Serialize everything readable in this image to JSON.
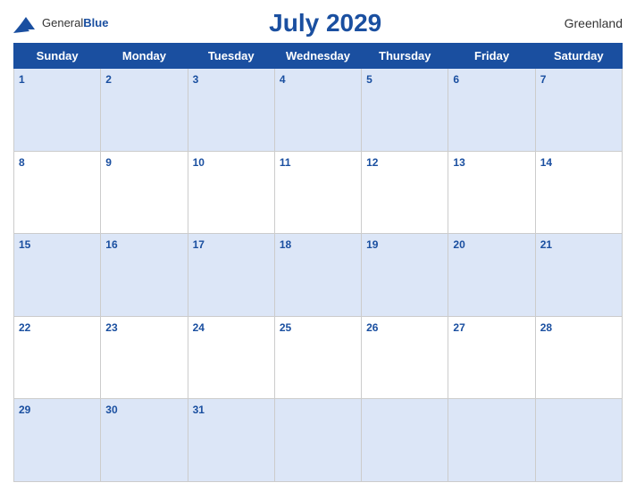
{
  "header": {
    "logo_general": "General",
    "logo_blue": "Blue",
    "title": "July 2029",
    "region": "Greenland"
  },
  "calendar": {
    "days_of_week": [
      "Sunday",
      "Monday",
      "Tuesday",
      "Wednesday",
      "Thursday",
      "Friday",
      "Saturday"
    ],
    "weeks": [
      [
        {
          "day": 1,
          "empty": false
        },
        {
          "day": 2,
          "empty": false
        },
        {
          "day": 3,
          "empty": false
        },
        {
          "day": 4,
          "empty": false
        },
        {
          "day": 5,
          "empty": false
        },
        {
          "day": 6,
          "empty": false
        },
        {
          "day": 7,
          "empty": false
        }
      ],
      [
        {
          "day": 8,
          "empty": false
        },
        {
          "day": 9,
          "empty": false
        },
        {
          "day": 10,
          "empty": false
        },
        {
          "day": 11,
          "empty": false
        },
        {
          "day": 12,
          "empty": false
        },
        {
          "day": 13,
          "empty": false
        },
        {
          "day": 14,
          "empty": false
        }
      ],
      [
        {
          "day": 15,
          "empty": false
        },
        {
          "day": 16,
          "empty": false
        },
        {
          "day": 17,
          "empty": false
        },
        {
          "day": 18,
          "empty": false
        },
        {
          "day": 19,
          "empty": false
        },
        {
          "day": 20,
          "empty": false
        },
        {
          "day": 21,
          "empty": false
        }
      ],
      [
        {
          "day": 22,
          "empty": false
        },
        {
          "day": 23,
          "empty": false
        },
        {
          "day": 24,
          "empty": false
        },
        {
          "day": 25,
          "empty": false
        },
        {
          "day": 26,
          "empty": false
        },
        {
          "day": 27,
          "empty": false
        },
        {
          "day": 28,
          "empty": false
        }
      ],
      [
        {
          "day": 29,
          "empty": false
        },
        {
          "day": 30,
          "empty": false
        },
        {
          "day": 31,
          "empty": false
        },
        {
          "day": null,
          "empty": true
        },
        {
          "day": null,
          "empty": true
        },
        {
          "day": null,
          "empty": true
        },
        {
          "day": null,
          "empty": true
        }
      ]
    ]
  }
}
